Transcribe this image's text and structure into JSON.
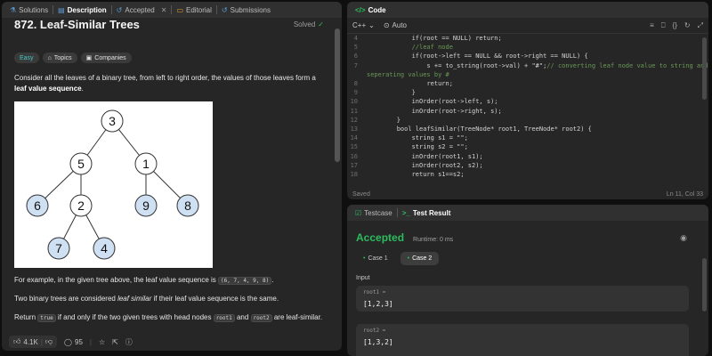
{
  "left_tabs": [
    {
      "label": "Solutions",
      "icon": "flask-icon"
    },
    {
      "label": "Description",
      "icon": "document-icon"
    },
    {
      "label": "Accepted",
      "icon": "history-icon"
    },
    {
      "label": "Editorial",
      "icon": "book-icon"
    },
    {
      "label": "Submissions",
      "icon": "history-icon"
    }
  ],
  "problem": {
    "title": "872. Leaf-Similar Trees",
    "status": "Solved",
    "difficulty": "Easy",
    "topics_label": "Topics",
    "companies_label": "Companies",
    "intro_a": "Consider all the leaves of a binary tree, from left to right order, the values of those leaves form a ",
    "intro_bold": "leaf value sequence",
    "intro_b": ".",
    "example_a": "For example, in the given tree above, the leaf value sequence is ",
    "example_code": "(6, 7, 4, 9, 8)",
    "example_b": ".",
    "similar_a": "Two binary trees are considered ",
    "similar_em": "leaf similar",
    "similar_b": " if their leaf value sequence is the same.",
    "return_a": "Return ",
    "return_code1": "true",
    "return_b": " if and only if the two given trees with head nodes ",
    "return_code2": "root1",
    "return_c": " and ",
    "return_code3": "root2",
    "return_d": " are leaf-similar."
  },
  "tree": {
    "nodes": [
      {
        "id": "3",
        "label": "3"
      },
      {
        "id": "5",
        "label": "5"
      },
      {
        "id": "1",
        "label": "1"
      },
      {
        "id": "6",
        "label": "6"
      },
      {
        "id": "2",
        "label": "2"
      },
      {
        "id": "9",
        "label": "9"
      },
      {
        "id": "8",
        "label": "8"
      },
      {
        "id": "7",
        "label": "7"
      },
      {
        "id": "4",
        "label": "4"
      }
    ],
    "colors": {
      "inner": "#ffffff",
      "leaf": "#cfe0f3",
      "stroke": "#333333"
    }
  },
  "bottom_bar": {
    "likes": "4.1K",
    "comments": "95"
  },
  "code_panel": {
    "title": "Code",
    "language": "C++",
    "mode": "Auto",
    "status_saved": "Saved",
    "cursor": "Ln 11, Col 33",
    "lines": [
      {
        "n": "4",
        "t": "            if(root == NULL) return;"
      },
      {
        "n": "5",
        "t": "            //leaf node"
      },
      {
        "n": "6",
        "t": "            if(root->left == NULL && root->right == NULL) {"
      },
      {
        "n": "7",
        "t": "                s += to_string(root->val) + \"#\";// converting leaf node value to string and seperating values by #"
      },
      {
        "n": "8",
        "t": "                return;"
      },
      {
        "n": "9",
        "t": "            }"
      },
      {
        "n": "10",
        "t": "            inOrder(root->left, s);"
      },
      {
        "n": "11",
        "t": "            inOrder(root->right, s);"
      },
      {
        "n": "12",
        "t": "        }"
      },
      {
        "n": "13",
        "t": "        bool leafSimilar(TreeNode* root1, TreeNode* root2) {"
      },
      {
        "n": "14",
        "t": "            string s1 = \"\";"
      },
      {
        "n": "15",
        "t": "            string s2 = \"\";"
      },
      {
        "n": "16",
        "t": "            inOrder(root1, s1);"
      },
      {
        "n": "17",
        "t": "            inOrder(root2, s2);"
      },
      {
        "n": "18",
        "t": "            return s1==s2;"
      }
    ]
  },
  "result_panel": {
    "tab_testcase": "Testcase",
    "tab_result": "Test Result",
    "verdict": "Accepted",
    "runtime": "Runtime: 0 ms",
    "cases": [
      "Case 1",
      "Case 2"
    ],
    "input_label": "Input",
    "inputs": [
      {
        "name": "root1 =",
        "value": "[1,2,3]"
      },
      {
        "name": "root2 =",
        "value": "[1,3,2]"
      }
    ]
  },
  "colors": {
    "accent_green": "#2cbb5d",
    "easy": "#46c6c2",
    "bg": "#262626"
  }
}
